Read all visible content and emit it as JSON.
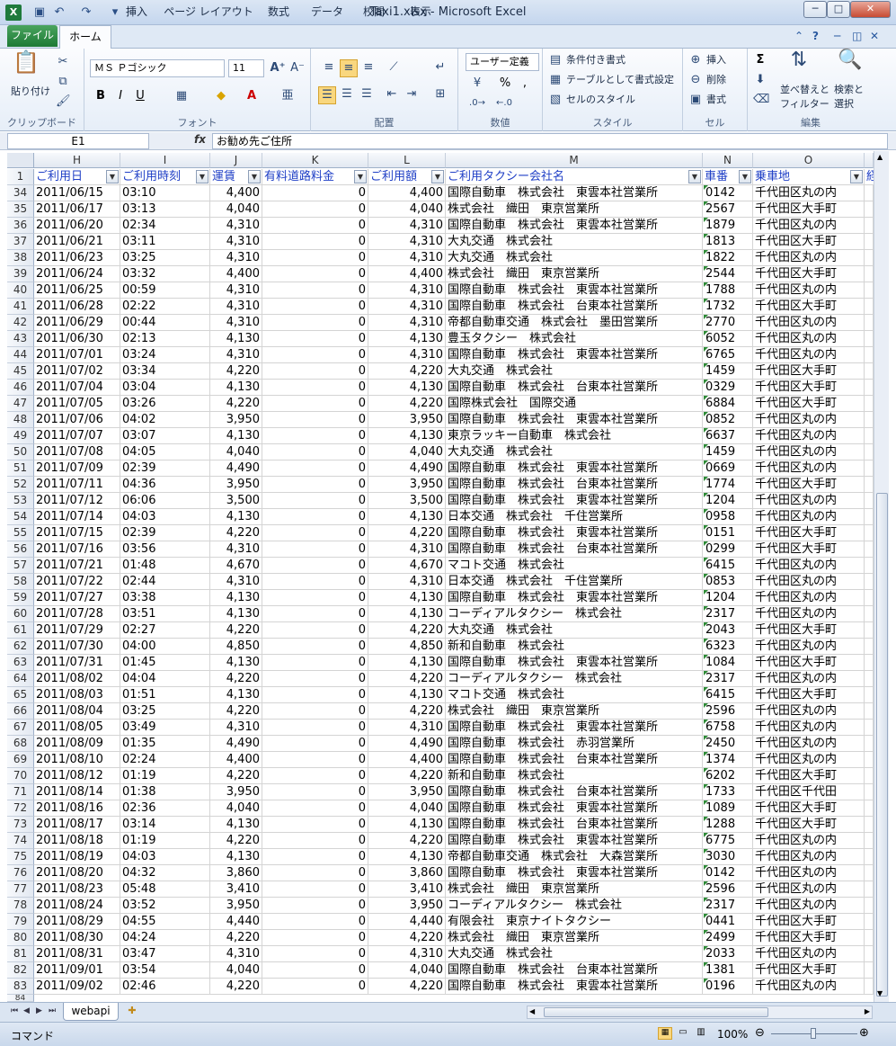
{
  "window": {
    "title": "Taxi1.xlsx - Microsoft Excel",
    "logo": "X",
    "minimize": "─",
    "restore": "□",
    "close": "✕"
  },
  "ribbon_tabs": [
    "ファイル",
    "ホーム",
    "挿入",
    "ページ レイアウト",
    "数式",
    "データ",
    "校閲",
    "表示"
  ],
  "ribbon": {
    "clipboard": {
      "paste": "貼り付け",
      "label": "クリップボード"
    },
    "font": {
      "name": "ＭＳ Ｐゴシック",
      "size": "11",
      "label": "フォント",
      "bold": "B",
      "italic": "I",
      "underline": "U"
    },
    "alignment": {
      "label": "配置"
    },
    "number": {
      "format": "ユーザー定義",
      "label": "数値",
      "percent": "%",
      "comma": ","
    },
    "styles": {
      "conditional": "条件付き書式",
      "table": "テーブルとして書式設定",
      "cell_styles": "セルのスタイル",
      "label": "スタイル"
    },
    "cells": {
      "insert": "挿入",
      "delete": "削除",
      "format": "書式",
      "label": "セル"
    },
    "editing": {
      "sum": "Σ",
      "sort": "並べ替えと",
      "filter": "フィルター",
      "find": "検索と",
      "select": "選択",
      "label": "編集"
    }
  },
  "formula_bar": {
    "cell_ref": "E1",
    "fx": "fx",
    "content": "お勧め先ご住所"
  },
  "columns": [
    "H",
    "I",
    "J",
    "K",
    "L",
    "M",
    "N",
    "O"
  ],
  "headers": [
    "ご利用日",
    "ご利用時刻",
    "運賃",
    "有料道路料金",
    "ご利用額",
    "ご利用タクシー会社名",
    "車番",
    "乗車地",
    "経"
  ],
  "rows": [
    {
      "n": "34",
      "d": "2011/06/15",
      "t": "03:10",
      "f": "4,400",
      "k": "0",
      "a": "4,400",
      "c": "国際自動車　株式会社　東雲本社営業所",
      "no": "0142",
      "p": "千代田区丸の内"
    },
    {
      "n": "35",
      "d": "2011/06/17",
      "t": "03:13",
      "f": "4,040",
      "k": "0",
      "a": "4,040",
      "c": "株式会社　織田　東京営業所",
      "no": "2567",
      "p": "千代田区大手町"
    },
    {
      "n": "36",
      "d": "2011/06/20",
      "t": "02:34",
      "f": "4,310",
      "k": "0",
      "a": "4,310",
      "c": "国際自動車　株式会社　東雲本社営業所",
      "no": "1879",
      "p": "千代田区丸の内"
    },
    {
      "n": "37",
      "d": "2011/06/21",
      "t": "03:11",
      "f": "4,310",
      "k": "0",
      "a": "4,310",
      "c": "大丸交通　株式会社",
      "no": "1813",
      "p": "千代田区大手町"
    },
    {
      "n": "38",
      "d": "2011/06/23",
      "t": "03:25",
      "f": "4,310",
      "k": "0",
      "a": "4,310",
      "c": "大丸交通　株式会社",
      "no": "1822",
      "p": "千代田区丸の内"
    },
    {
      "n": "39",
      "d": "2011/06/24",
      "t": "03:32",
      "f": "4,400",
      "k": "0",
      "a": "4,400",
      "c": "株式会社　織田　東京営業所",
      "no": "2544",
      "p": "千代田区大手町"
    },
    {
      "n": "40",
      "d": "2011/06/25",
      "t": "00:59",
      "f": "4,310",
      "k": "0",
      "a": "4,310",
      "c": "国際自動車　株式会社　東雲本社営業所",
      "no": "1788",
      "p": "千代田区丸の内"
    },
    {
      "n": "41",
      "d": "2011/06/28",
      "t": "02:22",
      "f": "4,310",
      "k": "0",
      "a": "4,310",
      "c": "国際自動車　株式会社　台東本社営業所",
      "no": "1732",
      "p": "千代田区大手町"
    },
    {
      "n": "42",
      "d": "2011/06/29",
      "t": "00:44",
      "f": "4,310",
      "k": "0",
      "a": "4,310",
      "c": "帝都自動車交通　株式会社　墨田営業所",
      "no": "2770",
      "p": "千代田区丸の内"
    },
    {
      "n": "43",
      "d": "2011/06/30",
      "t": "02:13",
      "f": "4,130",
      "k": "0",
      "a": "4,130",
      "c": "豊玉タクシー　株式会社",
      "no": "6052",
      "p": "千代田区丸の内"
    },
    {
      "n": "44",
      "d": "2011/07/01",
      "t": "03:24",
      "f": "4,310",
      "k": "0",
      "a": "4,310",
      "c": "国際自動車　株式会社　東雲本社営業所",
      "no": "6765",
      "p": "千代田区丸の内"
    },
    {
      "n": "45",
      "d": "2011/07/02",
      "t": "03:34",
      "f": "4,220",
      "k": "0",
      "a": "4,220",
      "c": "大丸交通　株式会社",
      "no": "1459",
      "p": "千代田区大手町"
    },
    {
      "n": "46",
      "d": "2011/07/04",
      "t": "03:04",
      "f": "4,130",
      "k": "0",
      "a": "4,130",
      "c": "国際自動車　株式会社　台東本社営業所",
      "no": "0329",
      "p": "千代田区大手町"
    },
    {
      "n": "47",
      "d": "2011/07/05",
      "t": "03:26",
      "f": "4,220",
      "k": "0",
      "a": "4,220",
      "c": "国際株式会社　国際交通",
      "no": "6884",
      "p": "千代田区大手町"
    },
    {
      "n": "48",
      "d": "2011/07/06",
      "t": "04:02",
      "f": "3,950",
      "k": "0",
      "a": "3,950",
      "c": "国際自動車　株式会社　東雲本社営業所",
      "no": "0852",
      "p": "千代田区丸の内"
    },
    {
      "n": "49",
      "d": "2011/07/07",
      "t": "03:07",
      "f": "4,130",
      "k": "0",
      "a": "4,130",
      "c": "東京ラッキー自動車　株式会社",
      "no": "6637",
      "p": "千代田区丸の内"
    },
    {
      "n": "50",
      "d": "2011/07/08",
      "t": "04:05",
      "f": "4,040",
      "k": "0",
      "a": "4,040",
      "c": "大丸交通　株式会社",
      "no": "1459",
      "p": "千代田区丸の内"
    },
    {
      "n": "51",
      "d": "2011/07/09",
      "t": "02:39",
      "f": "4,490",
      "k": "0",
      "a": "4,490",
      "c": "国際自動車　株式会社　東雲本社営業所",
      "no": "0669",
      "p": "千代田区丸の内"
    },
    {
      "n": "52",
      "d": "2011/07/11",
      "t": "04:36",
      "f": "3,950",
      "k": "0",
      "a": "3,950",
      "c": "国際自動車　株式会社　台東本社営業所",
      "no": "1774",
      "p": "千代田区大手町"
    },
    {
      "n": "53",
      "d": "2011/07/12",
      "t": "06:06",
      "f": "3,500",
      "k": "0",
      "a": "3,500",
      "c": "国際自動車　株式会社　東雲本社営業所",
      "no": "1204",
      "p": "千代田区丸の内"
    },
    {
      "n": "54",
      "d": "2011/07/14",
      "t": "04:03",
      "f": "4,130",
      "k": "0",
      "a": "4,130",
      "c": "日本交通　株式会社　千住営業所",
      "no": "0958",
      "p": "千代田区丸の内"
    },
    {
      "n": "55",
      "d": "2011/07/15",
      "t": "02:39",
      "f": "4,220",
      "k": "0",
      "a": "4,220",
      "c": "国際自動車　株式会社　東雲本社営業所",
      "no": "0151",
      "p": "千代田区大手町"
    },
    {
      "n": "56",
      "d": "2011/07/16",
      "t": "03:56",
      "f": "4,310",
      "k": "0",
      "a": "4,310",
      "c": "国際自動車　株式会社　台東本社営業所",
      "no": "0299",
      "p": "千代田区大手町"
    },
    {
      "n": "57",
      "d": "2011/07/21",
      "t": "01:48",
      "f": "4,670",
      "k": "0",
      "a": "4,670",
      "c": "マコト交通　株式会社",
      "no": "6415",
      "p": "千代田区丸の内"
    },
    {
      "n": "58",
      "d": "2011/07/22",
      "t": "02:44",
      "f": "4,310",
      "k": "0",
      "a": "4,310",
      "c": "日本交通　株式会社　千住営業所",
      "no": "0853",
      "p": "千代田区丸の内"
    },
    {
      "n": "59",
      "d": "2011/07/27",
      "t": "03:38",
      "f": "4,130",
      "k": "0",
      "a": "4,130",
      "c": "国際自動車　株式会社　東雲本社営業所",
      "no": "1204",
      "p": "千代田区丸の内"
    },
    {
      "n": "60",
      "d": "2011/07/28",
      "t": "03:51",
      "f": "4,130",
      "k": "0",
      "a": "4,130",
      "c": "コーディアルタクシー　株式会社",
      "no": "2317",
      "p": "千代田区丸の内"
    },
    {
      "n": "61",
      "d": "2011/07/29",
      "t": "02:27",
      "f": "4,220",
      "k": "0",
      "a": "4,220",
      "c": "大丸交通　株式会社",
      "no": "2043",
      "p": "千代田区大手町"
    },
    {
      "n": "62",
      "d": "2011/07/30",
      "t": "04:00",
      "f": "4,850",
      "k": "0",
      "a": "4,850",
      "c": "新和自動車　株式会社",
      "no": "6323",
      "p": "千代田区丸の内"
    },
    {
      "n": "63",
      "d": "2011/07/31",
      "t": "01:45",
      "f": "4,130",
      "k": "0",
      "a": "4,130",
      "c": "国際自動車　株式会社　東雲本社営業所",
      "no": "1084",
      "p": "千代田区大手町"
    },
    {
      "n": "64",
      "d": "2011/08/02",
      "t": "04:04",
      "f": "4,220",
      "k": "0",
      "a": "4,220",
      "c": "コーディアルタクシー　株式会社",
      "no": "2317",
      "p": "千代田区丸の内"
    },
    {
      "n": "65",
      "d": "2011/08/03",
      "t": "01:51",
      "f": "4,130",
      "k": "0",
      "a": "4,130",
      "c": "マコト交通　株式会社",
      "no": "6415",
      "p": "千代田区大手町"
    },
    {
      "n": "66",
      "d": "2011/08/04",
      "t": "03:25",
      "f": "4,220",
      "k": "0",
      "a": "4,220",
      "c": "株式会社　織田　東京営業所",
      "no": "2596",
      "p": "千代田区丸の内"
    },
    {
      "n": "67",
      "d": "2011/08/05",
      "t": "03:49",
      "f": "4,310",
      "k": "0",
      "a": "4,310",
      "c": "国際自動車　株式会社　東雲本社営業所",
      "no": "6758",
      "p": "千代田区丸の内"
    },
    {
      "n": "68",
      "d": "2011/08/09",
      "t": "01:35",
      "f": "4,490",
      "k": "0",
      "a": "4,490",
      "c": "国際自動車　株式会社　赤羽営業所",
      "no": "2450",
      "p": "千代田区丸の内"
    },
    {
      "n": "69",
      "d": "2011/08/10",
      "t": "02:24",
      "f": "4,400",
      "k": "0",
      "a": "4,400",
      "c": "国際自動車　株式会社　台東本社営業所",
      "no": "1374",
      "p": "千代田区丸の内"
    },
    {
      "n": "70",
      "d": "2011/08/12",
      "t": "01:19",
      "f": "4,220",
      "k": "0",
      "a": "4,220",
      "c": "新和自動車　株式会社",
      "no": "6202",
      "p": "千代田区大手町"
    },
    {
      "n": "71",
      "d": "2011/08/14",
      "t": "01:38",
      "f": "3,950",
      "k": "0",
      "a": "3,950",
      "c": "国際自動車　株式会社　台東本社営業所",
      "no": "1733",
      "p": "千代田区千代田"
    },
    {
      "n": "72",
      "d": "2011/08/16",
      "t": "02:36",
      "f": "4,040",
      "k": "0",
      "a": "4,040",
      "c": "国際自動車　株式会社　東雲本社営業所",
      "no": "1089",
      "p": "千代田区大手町"
    },
    {
      "n": "73",
      "d": "2011/08/17",
      "t": "03:14",
      "f": "4,130",
      "k": "0",
      "a": "4,130",
      "c": "国際自動車　株式会社　台東本社営業所",
      "no": "1288",
      "p": "千代田区大手町"
    },
    {
      "n": "74",
      "d": "2011/08/18",
      "t": "01:19",
      "f": "4,220",
      "k": "0",
      "a": "4,220",
      "c": "国際自動車　株式会社　東雲本社営業所",
      "no": "6775",
      "p": "千代田区丸の内"
    },
    {
      "n": "75",
      "d": "2011/08/19",
      "t": "04:03",
      "f": "4,130",
      "k": "0",
      "a": "4,130",
      "c": "帝都自動車交通　株式会社　大森営業所",
      "no": "3030",
      "p": "千代田区丸の内"
    },
    {
      "n": "76",
      "d": "2011/08/20",
      "t": "04:32",
      "f": "3,860",
      "k": "0",
      "a": "3,860",
      "c": "国際自動車　株式会社　東雲本社営業所",
      "no": "0142",
      "p": "千代田区丸の内"
    },
    {
      "n": "77",
      "d": "2011/08/23",
      "t": "05:48",
      "f": "3,410",
      "k": "0",
      "a": "3,410",
      "c": "株式会社　織田　東京営業所",
      "no": "2596",
      "p": "千代田区丸の内"
    },
    {
      "n": "78",
      "d": "2011/08/24",
      "t": "03:52",
      "f": "3,950",
      "k": "0",
      "a": "3,950",
      "c": "コーディアルタクシー　株式会社",
      "no": "2317",
      "p": "千代田区丸の内"
    },
    {
      "n": "79",
      "d": "2011/08/29",
      "t": "04:55",
      "f": "4,440",
      "k": "0",
      "a": "4,440",
      "c": "有限会社　東京ナイトタクシー",
      "no": "0441",
      "p": "千代田区大手町"
    },
    {
      "n": "80",
      "d": "2011/08/30",
      "t": "04:24",
      "f": "4,220",
      "k": "0",
      "a": "4,220",
      "c": "株式会社　織田　東京営業所",
      "no": "2499",
      "p": "千代田区大手町"
    },
    {
      "n": "81",
      "d": "2011/08/31",
      "t": "03:47",
      "f": "4,310",
      "k": "0",
      "a": "4,310",
      "c": "大丸交通　株式会社",
      "no": "2033",
      "p": "千代田区丸の内"
    },
    {
      "n": "82",
      "d": "2011/09/01",
      "t": "03:54",
      "f": "4,040",
      "k": "0",
      "a": "4,040",
      "c": "国際自動車　株式会社　台東本社営業所",
      "no": "1381",
      "p": "千代田区大手町"
    },
    {
      "n": "83",
      "d": "2011/09/02",
      "t": "02:46",
      "f": "4,220",
      "k": "0",
      "a": "4,220",
      "c": "国際自動車　株式会社　東雲本社営業所",
      "no": "0196",
      "p": "千代田区丸の内"
    }
  ],
  "row_84": "84",
  "sheet": {
    "tab": "webapi"
  },
  "status": {
    "mode": "コマンド",
    "zoom": "100%"
  },
  "colors": {
    "header_text": "#1f3fc6",
    "excel_green": "#1d7a35",
    "error_triangle": "#2e8b37"
  },
  "icons": [
    "excel-logo-icon",
    "save-icon",
    "undo-icon",
    "redo-icon",
    "help-icon",
    "filter-dropdown-icon",
    "zoom-out-icon",
    "zoom-in-icon"
  ]
}
